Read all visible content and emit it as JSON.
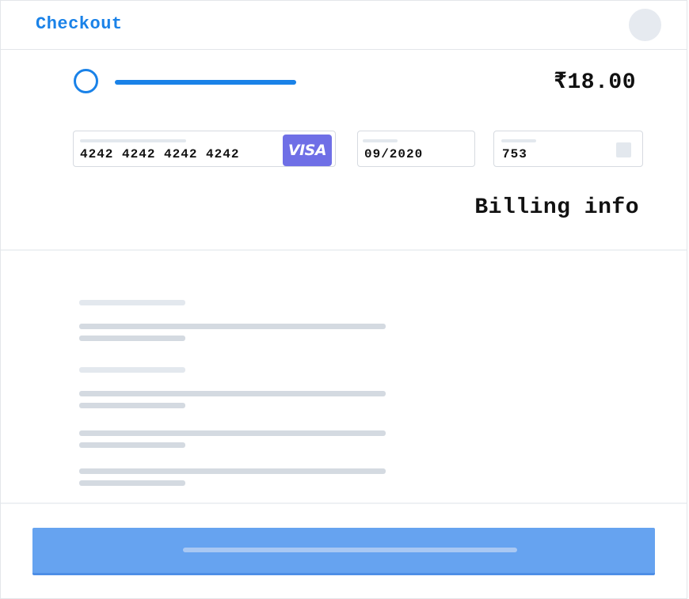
{
  "header": {
    "title": "Checkout"
  },
  "summary": {
    "progress_percent": 100,
    "amount": "₹18.00"
  },
  "payment": {
    "card_number": "4242 4242 4242 4242",
    "card_brand": "VISA",
    "card_brand_icon": "visa-logo",
    "expiry": "09/2020",
    "cvc": "753",
    "cvc_icon": "cvc-card-icon"
  },
  "billing": {
    "heading": "Billing info"
  },
  "colors": {
    "accent": "#1a82e8",
    "brand_badge": "#6f6fe6",
    "button": "#66a3f0"
  }
}
